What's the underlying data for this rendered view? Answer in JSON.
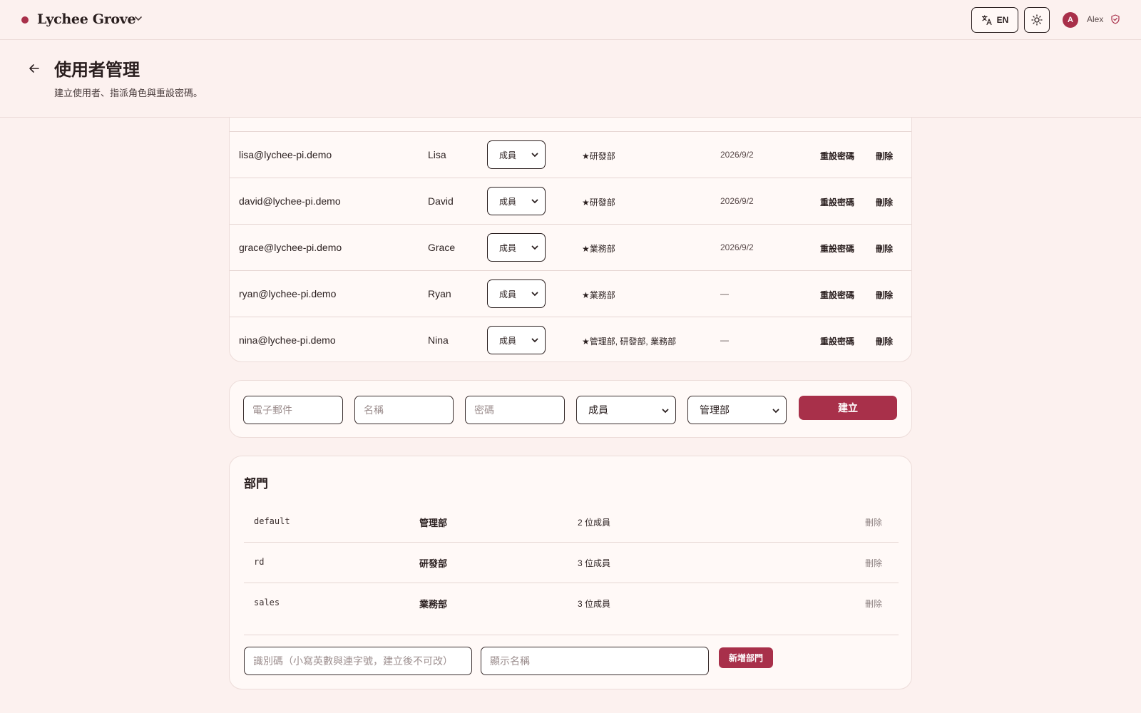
{
  "brand": {
    "name": "Lychee Grove"
  },
  "topbar": {
    "lang_label": "EN",
    "user_initial": "A",
    "user_name": "Alex"
  },
  "header": {
    "title": "使用者管理",
    "subtitle": "建立使用者、指派角色與重設密碼。"
  },
  "users": {
    "rows": [
      {
        "email": "lisa@lychee-pi.demo",
        "name": "Lisa",
        "role": "成員",
        "departments": "★研發部",
        "date": "2026/9/2",
        "reset": "重設密碼",
        "delete": "刪除"
      },
      {
        "email": "david@lychee-pi.demo",
        "name": "David",
        "role": "成員",
        "departments": "★研發部",
        "date": "2026/9/2",
        "reset": "重設密碼",
        "delete": "刪除"
      },
      {
        "email": "grace@lychee-pi.demo",
        "name": "Grace",
        "role": "成員",
        "departments": "★業務部",
        "date": "2026/9/2",
        "reset": "重設密碼",
        "delete": "刪除"
      },
      {
        "email": "ryan@lychee-pi.demo",
        "name": "Ryan",
        "role": "成員",
        "departments": "★業務部",
        "date": "—",
        "reset": "重設密碼",
        "delete": "刪除"
      },
      {
        "email": "nina@lychee-pi.demo",
        "name": "Nina",
        "role": "成員",
        "departments": "★管理部, 研發部, 業務部",
        "date": "—",
        "reset": "重設密碼",
        "delete": "刪除"
      }
    ]
  },
  "create_form": {
    "email_placeholder": "電子郵件",
    "name_placeholder": "名稱",
    "password_placeholder": "密碼",
    "role_value": "成員",
    "dept_value": "管理部",
    "submit_label": "建立"
  },
  "departments": {
    "title": "部門",
    "rows": [
      {
        "code": "default",
        "name": "管理部",
        "count": "2 位成員",
        "delete": "刪除"
      },
      {
        "code": "rd",
        "name": "研發部",
        "count": "3 位成員",
        "delete": "刪除"
      },
      {
        "code": "sales",
        "name": "業務部",
        "count": "3 位成員",
        "delete": "刪除"
      }
    ],
    "code_placeholder": "識別碼（小寫英數與連字號，建立後不可改）",
    "display_name_placeholder": "顯示名稱",
    "add_label": "新增部門"
  },
  "colors": {
    "accent": "#a8304a",
    "background": "#fcf1ef",
    "card": "#fff9f7"
  }
}
